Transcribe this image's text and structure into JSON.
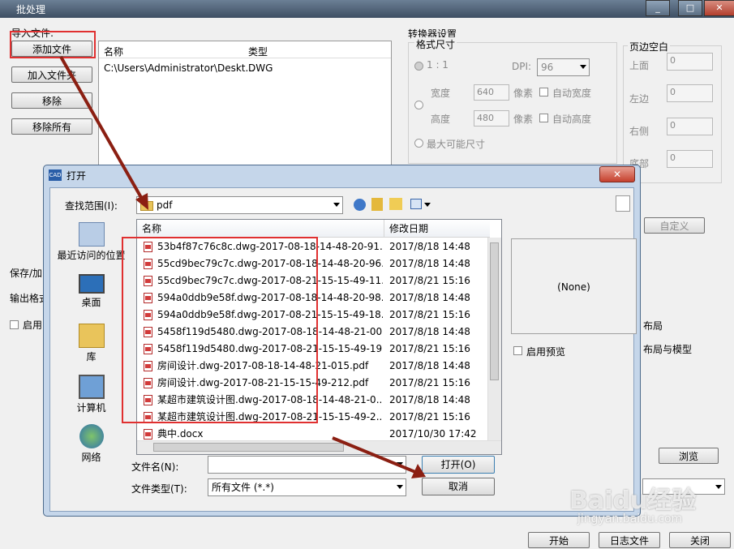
{
  "app": {
    "title": "批处理",
    "import_group": "导入文件:",
    "buttons": {
      "add_file": "添加文件",
      "add_folder": "加入文件夹",
      "remove": "移除",
      "remove_all": "移除所有"
    },
    "list_headers": {
      "name": "名称",
      "type": "类型"
    },
    "list_rows": [
      {
        "name": "C:\\Users\\Administrator\\Deskt...",
        "type": "DWG"
      }
    ],
    "converter": {
      "title": "转换器设置",
      "format_size": "格式尺寸",
      "ratio": "1 : 1",
      "dpi_label": "DPI:",
      "dpi_value": "96",
      "width_label": "宽度",
      "width_value": "640",
      "height_label": "高度",
      "height_value": "480",
      "pixel1": "像素",
      "pixel2": "像素",
      "auto_width": "自动宽度",
      "auto_height": "自动高度",
      "max_size": "最大可能尺寸"
    },
    "margins": {
      "title": "页边空白",
      "top": "上面",
      "top_value": "0",
      "left": "左边",
      "left_value": "0",
      "right": "右侧",
      "right_value": "0",
      "bottom": "底部",
      "bottom_value": "0"
    },
    "custom_button": "自定义",
    "save_label": "保存/加",
    "output_format_label": "输出格式",
    "enable_label": "启用",
    "layout_label": "布局",
    "layout_model_label": "布局与模型",
    "browse_button": "浏览",
    "bottom_buttons": {
      "start": "开始",
      "log": "日志文件",
      "close": "关闭"
    }
  },
  "dialog": {
    "title": "打开",
    "lookin_label": "查找范围(I):",
    "lookin_value": "pdf",
    "close": "✕",
    "places": [
      {
        "label": "最近访问的位置",
        "icon": "recent-places-icon"
      },
      {
        "label": "桌面",
        "icon": "desktop-icon"
      },
      {
        "label": "库",
        "icon": "libraries-icon"
      },
      {
        "label": "计算机",
        "icon": "computer-icon"
      },
      {
        "label": "网络",
        "icon": "network-icon"
      }
    ],
    "columns": {
      "name": "名称",
      "modified": "修改日期"
    },
    "files": [
      {
        "name": "53b4f87c76c8c.dwg-2017-08-18-14-48-20-91...",
        "date": "2017/8/18 14:48"
      },
      {
        "name": "55cd9bec79c7c.dwg-2017-08-18-14-48-20-96...",
        "date": "2017/8/18 14:48"
      },
      {
        "name": "55cd9bec79c7c.dwg-2017-08-21-15-15-49-11...",
        "date": "2017/8/21 15:16"
      },
      {
        "name": "594a0ddb9e58f.dwg-2017-08-18-14-48-20-98...",
        "date": "2017/8/18 14:48"
      },
      {
        "name": "594a0ddb9e58f.dwg-2017-08-21-15-15-49-18...",
        "date": "2017/8/21 15:16"
      },
      {
        "name": "5458f119d5480.dwg-2017-08-18-14-48-21-00...",
        "date": "2017/8/18 14:48"
      },
      {
        "name": "5458f119d5480.dwg-2017-08-21-15-15-49-19...",
        "date": "2017/8/21 15:16"
      },
      {
        "name": "房间设计.dwg-2017-08-18-14-48-21-015.pdf",
        "date": "2017/8/18 14:48"
      },
      {
        "name": "房间设计.dwg-2017-08-21-15-15-49-212.pdf",
        "date": "2017/8/21 15:16"
      },
      {
        "name": "某超市建筑设计图.dwg-2017-08-18-14-48-21-0...",
        "date": "2017/8/18 14:48"
      },
      {
        "name": "某超市建筑设计图.dwg-2017-08-21-15-15-49-2...",
        "date": "2017/8/21 15:16"
      },
      {
        "name": "典中.docx",
        "date": "2017/10/30 17:42"
      }
    ],
    "preview_text": "(None)",
    "enable_preview": "启用预览",
    "filename_label": "文件名(N):",
    "filename_value": "",
    "filetype_label": "文件类型(T):",
    "filetype_value": "所有文件 (*.*)",
    "open_button": "打开(O)",
    "cancel_button": "取消"
  },
  "watermark": {
    "brand": "Baidu经验",
    "url": "jingyan.baidu.com"
  }
}
